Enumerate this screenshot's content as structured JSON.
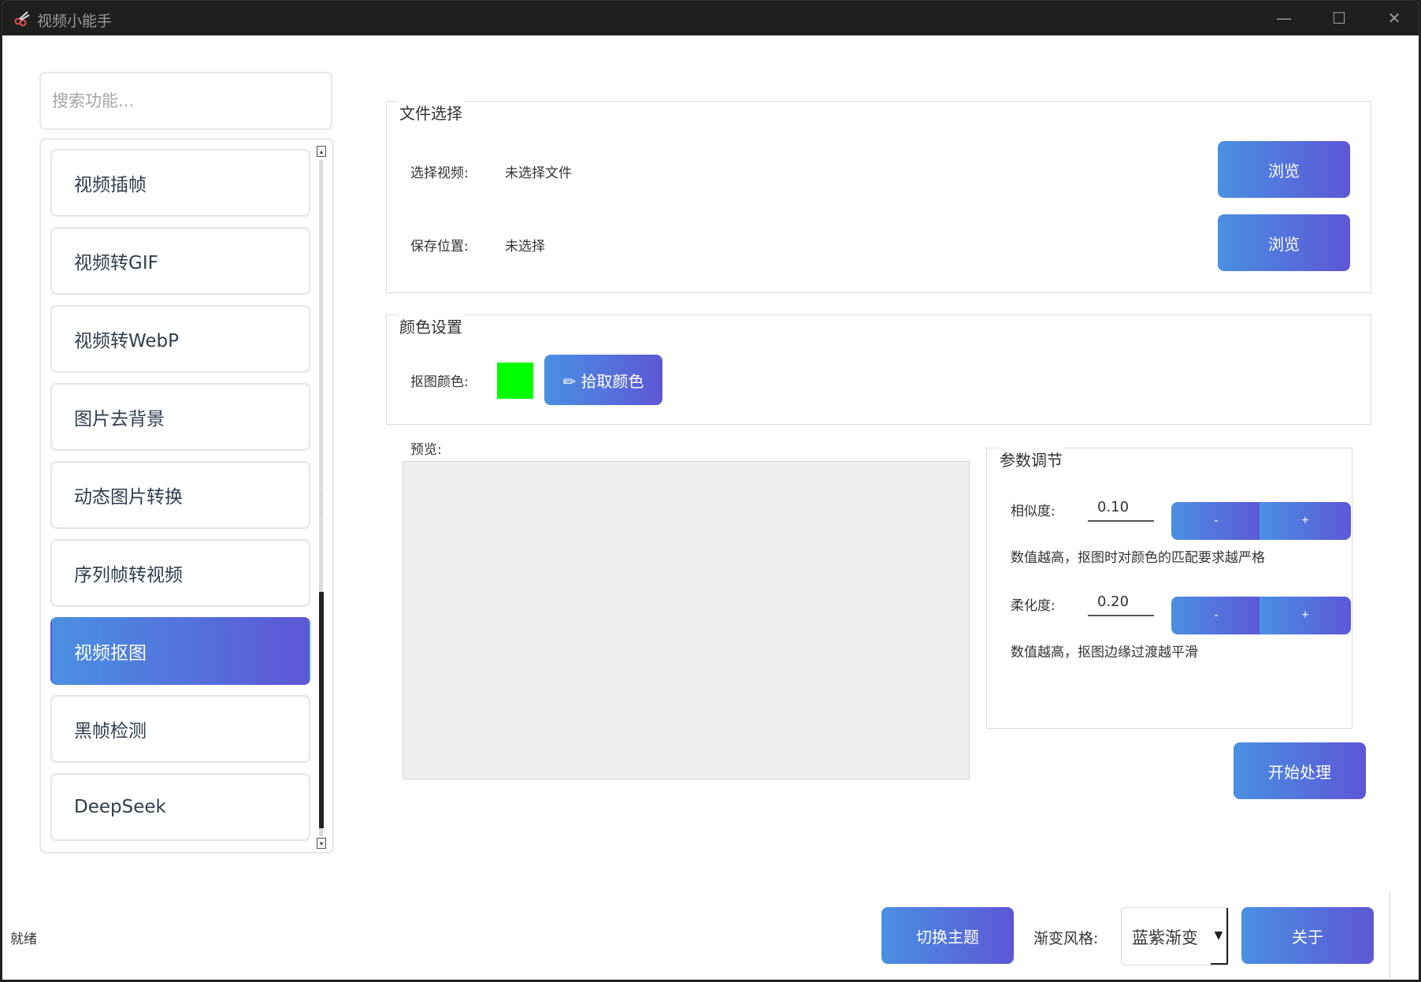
{
  "window": {
    "title": "视频小能手",
    "controls": {
      "minimize": "—",
      "maximize": "☐",
      "close": "✕"
    }
  },
  "sidebar": {
    "search_placeholder": "搜索功能...",
    "items": [
      {
        "label": "视频插帧",
        "active": false
      },
      {
        "label": "视频转GIF",
        "active": false
      },
      {
        "label": "视频转WebP",
        "active": false
      },
      {
        "label": "图片去背景",
        "active": false
      },
      {
        "label": "动态图片转换",
        "active": false
      },
      {
        "label": "序列帧转视频",
        "active": false
      },
      {
        "label": "视频抠图",
        "active": true
      },
      {
        "label": "黑帧检测",
        "active": false
      },
      {
        "label": "DeepSeek",
        "active": false
      }
    ]
  },
  "file_selection": {
    "title": "文件选择",
    "video_label": "选择视频:",
    "video_value": "未选择文件",
    "save_label": "保存位置:",
    "save_value": "未选择",
    "browse_label": "浏览"
  },
  "color_settings": {
    "title": "颜色设置",
    "key_color_label": "抠图颜色:",
    "key_color": "#00ff00",
    "pick_button": "✏ 拾取颜色"
  },
  "preview": {
    "label": "预览:"
  },
  "params": {
    "title": "参数调节",
    "similarity_label": "相似度:",
    "similarity_value": "0.10",
    "similarity_hint": "数值越高，抠图时对颜色的匹配要求越严格",
    "smoothness_label": "柔化度:",
    "smoothness_value": "0.20",
    "smoothness_hint": "数值越高，抠图边缘过渡越平滑",
    "minus": "-",
    "plus": "+"
  },
  "start_button": "开始处理",
  "bottom": {
    "status": "就绪",
    "theme_button": "切换主题",
    "style_label": "渐变风格:",
    "style_value": "蓝紫渐变",
    "about_button": "关于"
  },
  "colors": {
    "gradient_start": "#4a90e2",
    "gradient_end": "#5d57d6",
    "titlebar": "#1f1f1f"
  }
}
